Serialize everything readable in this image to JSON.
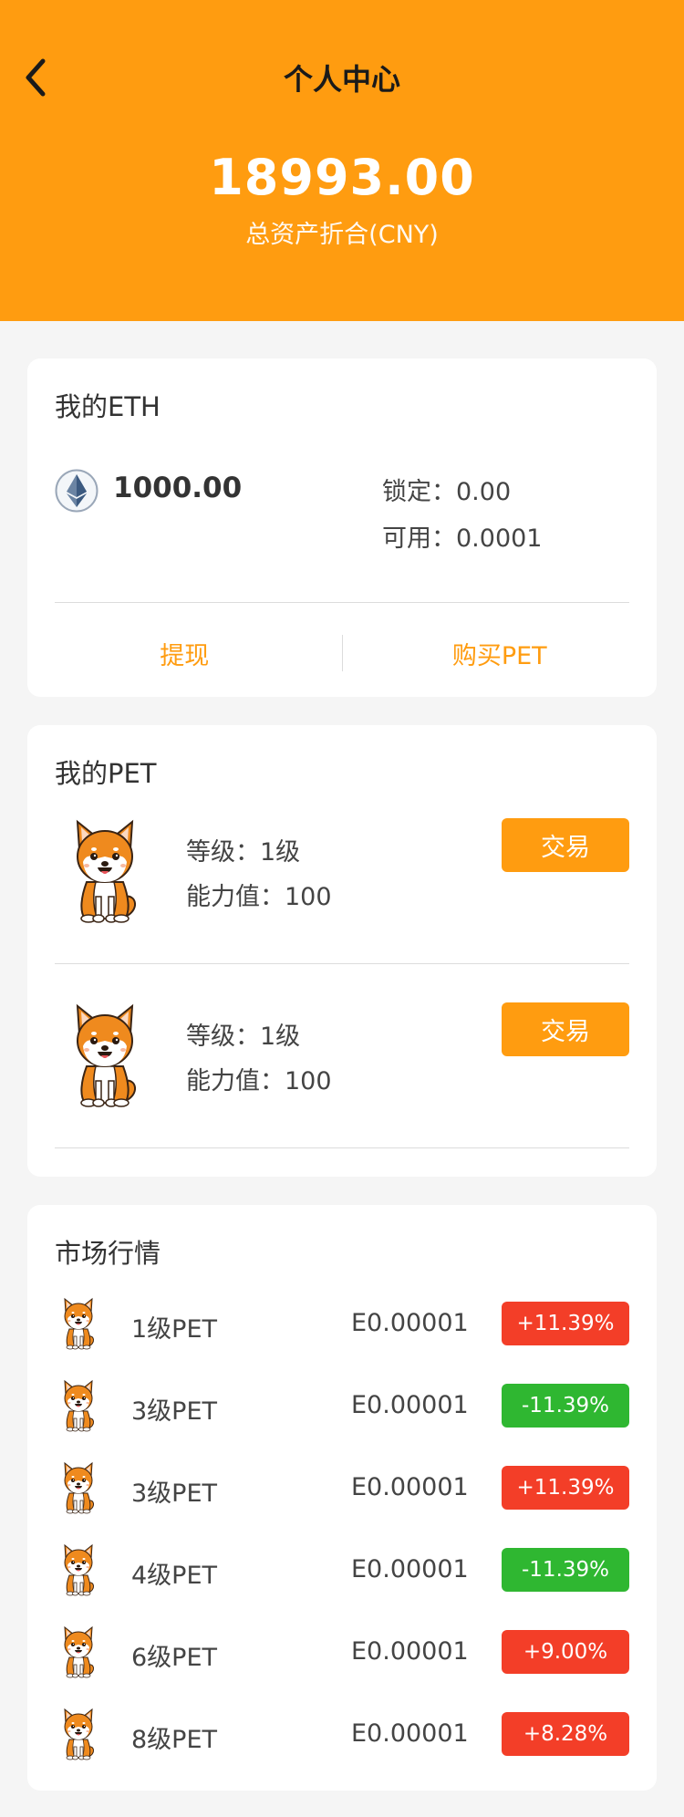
{
  "header": {
    "title": "个人中心",
    "total_amount": "18993.00",
    "total_label": "总资产折合(CNY)",
    "back_icon": "chevron-left-icon"
  },
  "eth": {
    "title": "我的ETH",
    "icon": "ethereum-icon",
    "balance": "1000.00",
    "locked": "锁定：0.00",
    "available": "可用：0.0001",
    "withdraw_label": "提现",
    "buy_label": "购买PET"
  },
  "pets": {
    "title": "我的PET",
    "items": [
      {
        "level": "等级：1级",
        "power": "能力值：100",
        "trade_label": "交易"
      },
      {
        "level": "等级：1级",
        "power": "能力值：100",
        "trade_label": "交易"
      }
    ]
  },
  "market": {
    "title": "市场行情",
    "rows": [
      {
        "name": "1级PET",
        "price": "E0.00001",
        "change": "+11.39%",
        "trend": "up"
      },
      {
        "name": "3级PET",
        "price": "E0.00001",
        "change": "-11.39%",
        "trend": "down"
      },
      {
        "name": "3级PET",
        "price": "E0.00001",
        "change": "+11.39%",
        "trend": "up"
      },
      {
        "name": "4级PET",
        "price": "E0.00001",
        "change": "-11.39%",
        "trend": "down"
      },
      {
        "name": "6级PET",
        "price": "E0.00001",
        "change": "+9.00%",
        "trend": "up"
      },
      {
        "name": "8级PET",
        "price": "E0.00001",
        "change": "+8.28%",
        "trend": "up"
      }
    ]
  },
  "colors": {
    "accent": "#ff9c10",
    "up": "#f33e28",
    "down": "#2fb731"
  }
}
